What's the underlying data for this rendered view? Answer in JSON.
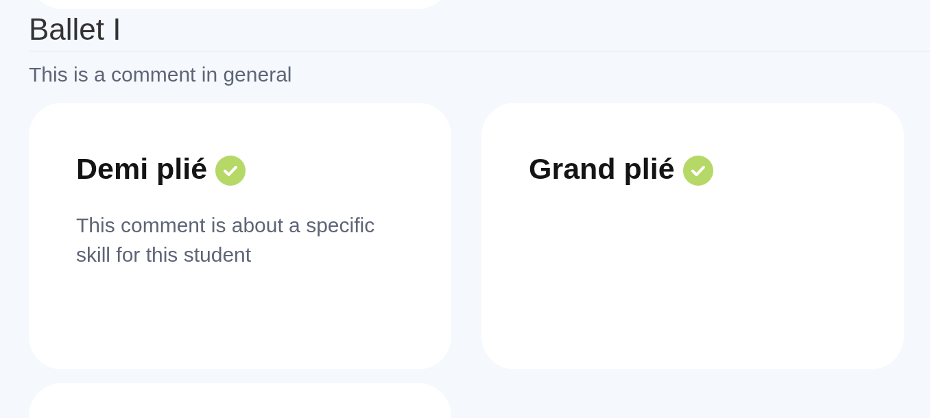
{
  "section": {
    "title": "Ballet I",
    "comment": "This is a comment in general"
  },
  "skills": [
    {
      "name": "Demi plié",
      "completed": true,
      "comment": "This comment is about a specific skill for this student"
    },
    {
      "name": "Grand plié",
      "completed": true
    }
  ]
}
